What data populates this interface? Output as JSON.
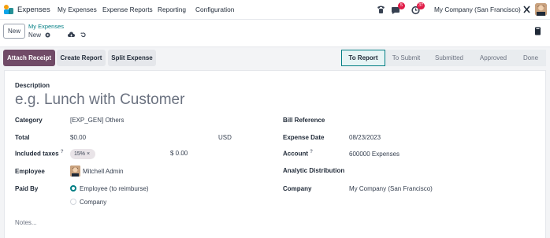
{
  "navbar": {
    "app_name": "Expenses",
    "menu": [
      "My Expenses",
      "Expense Reports",
      "Reporting",
      "Configuration"
    ],
    "messages_badge": "5",
    "activities_badge": "37",
    "company": "My Company (San Francisco)"
  },
  "control": {
    "new_label": "New",
    "breadcrumb_parent": "My Expenses",
    "breadcrumb_current": "New"
  },
  "actions": {
    "attach_receipt": "Attach Receipt",
    "create_report": "Create Report",
    "split_expense": "Split Expense"
  },
  "status": {
    "stages": [
      "To Report",
      "To Submit",
      "Submitted",
      "Approved",
      "Done"
    ],
    "active": "To Report"
  },
  "form": {
    "description_label": "Description",
    "description_placeholder": "e.g. Lunch with Customer",
    "category_label": "Category",
    "category_value": "[EXP_GEN] Others",
    "total_label": "Total",
    "total_value": "$0.00",
    "currency": "USD",
    "included_taxes_label": "Included taxes",
    "tax_tag": "15%",
    "tax_amount": "$ 0.00",
    "employee_label": "Employee",
    "employee_value": "Mitchell Admin",
    "paid_by_label": "Paid By",
    "paid_by_options": [
      "Employee (to reimburse)",
      "Company"
    ],
    "bill_reference_label": "Bill Reference",
    "expense_date_label": "Expense Date",
    "expense_date_value": "08/23/2023",
    "account_label": "Account",
    "account_value": "600000 Expenses",
    "analytic_label": "Analytic Distribution",
    "company_label": "Company",
    "company_value": "My Company (San Francisco)",
    "notes_placeholder": "Notes...",
    "help_marker": "?",
    "tag_remove": "×"
  },
  "colors": {
    "primary": "#714b67",
    "accent": "#017e84",
    "badge": "#e11d48"
  }
}
